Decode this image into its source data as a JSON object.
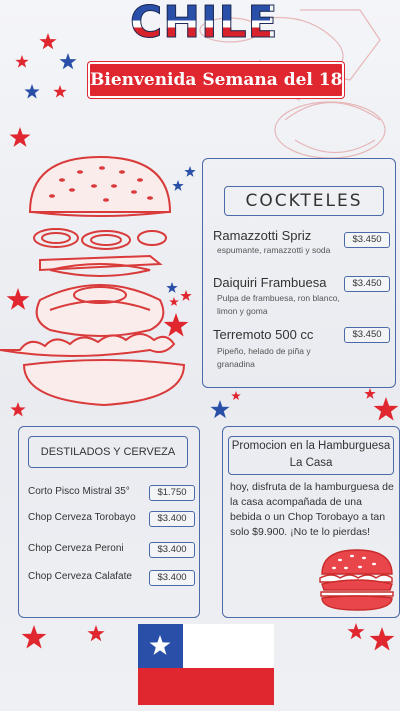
{
  "header": {
    "title": "CHILE",
    "banner": "Bienvenida Semana del 18"
  },
  "cocktails": {
    "heading": "COCKTELES",
    "items": [
      {
        "name": "Ramazzotti Spriz",
        "desc": "espumante, ramazzotti y soda",
        "price": "$3.450"
      },
      {
        "name": "Daiquiri Frambuesa",
        "desc": "Pulpa de frambuesa, ron blanco, limon y goma",
        "price": "$3.450"
      },
      {
        "name": "Terremoto 500 cc",
        "desc": "Pipeño, helado de piña y granadina",
        "price": "$3.450"
      }
    ]
  },
  "spirits": {
    "heading": "DESTILADOS Y CERVEZA",
    "items": [
      {
        "name": "Corto Pisco Mistral 35°",
        "price": "$1.750"
      },
      {
        "name": "Chop Cerveza Torobayo",
        "price": "$3.400"
      },
      {
        "name": "Chop Cerveza Peroni",
        "price": "$3.400"
      },
      {
        "name": "Chop Cerveza Calafate",
        "price": "$3.400"
      }
    ]
  },
  "promo": {
    "heading": "Promocion en la Hamburguesa La Casa",
    "text": "hoy, disfruta de la hamburguesa de la casa acompañada de una bebida o un Chop Torobayo a tan solo $9.900. ¡No te lo pierdas!"
  },
  "colors": {
    "red": "#e0262e",
    "blue": "#2a4fa8",
    "outline": "#4b6aa8",
    "sketch": "#d93a3a"
  },
  "icons": [
    "star-icon",
    "burger-illustration-icon",
    "small-burger-icon",
    "chile-flag-icon"
  ]
}
